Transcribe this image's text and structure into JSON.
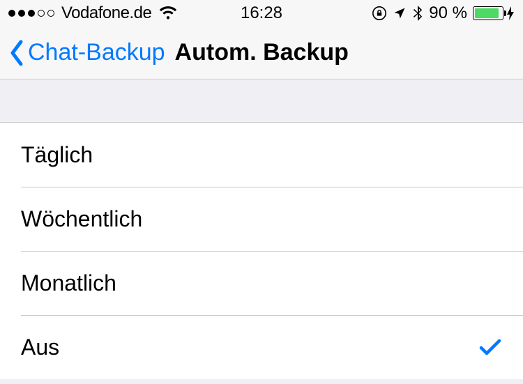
{
  "status_bar": {
    "carrier": "Vodafone.de",
    "time": "16:28",
    "battery_pct_label": "90 %",
    "battery_fill_pct": 90
  },
  "nav": {
    "back_label": "Chat-Backup",
    "title": "Autom. Backup"
  },
  "options": [
    {
      "label": "Täglich",
      "selected": false
    },
    {
      "label": "Wöchentlich",
      "selected": false
    },
    {
      "label": "Monatlich",
      "selected": false
    },
    {
      "label": "Aus",
      "selected": true
    }
  ]
}
